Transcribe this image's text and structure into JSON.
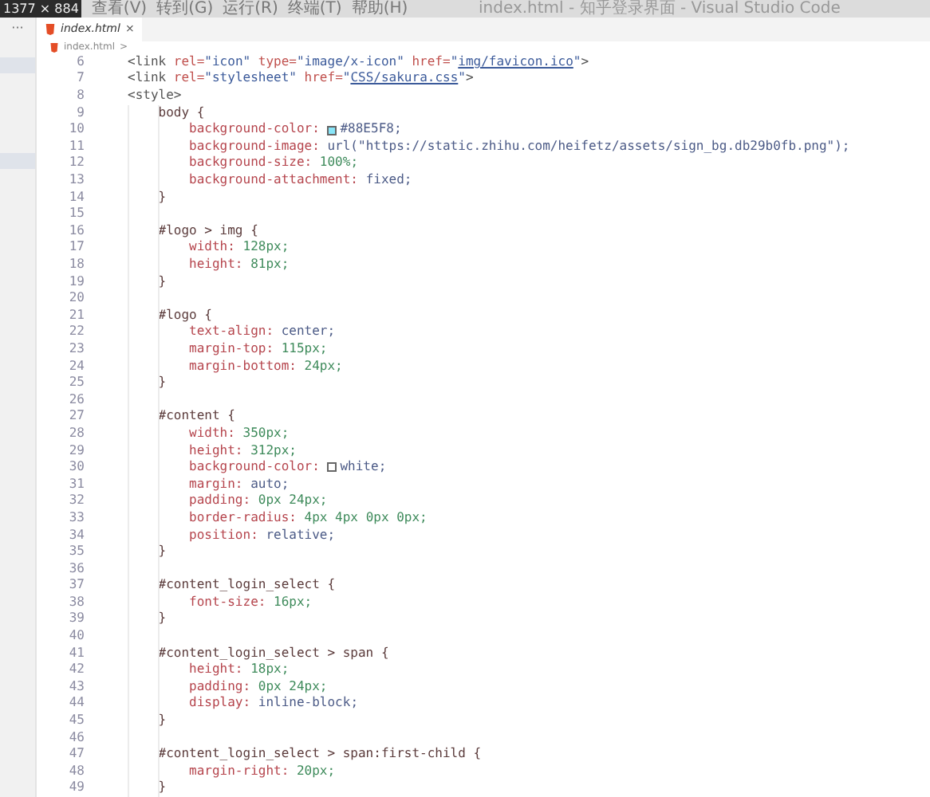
{
  "dimension_label": "1377 × 884",
  "menu": [
    "查看(V)",
    "转到(G)",
    "运行(R)",
    "终端(T)",
    "帮助(H)"
  ],
  "window": {
    "title": "index.html - 知乎登录界面 - Visual Studio Code"
  },
  "sidebar": {
    "overflow": "···"
  },
  "tabs": [
    {
      "label": "index.html",
      "selected": true,
      "close": "×"
    }
  ],
  "breadcrumb": [
    "index.html",
    ">"
  ],
  "lines": [
    {
      "n": "6",
      "tokens": [
        {
          "kind": "tag",
          "t": "<link "
        },
        {
          "kind": "attr",
          "t": "rel="
        },
        {
          "kind": "str",
          "t": "\"icon\" "
        },
        {
          "kind": "attr",
          "t": "type="
        },
        {
          "kind": "str",
          "t": "\"image/x-icon\" "
        },
        {
          "kind": "attr",
          "t": "href="
        },
        {
          "kind": "str",
          "t": "\""
        },
        {
          "kind": "link",
          "t": "img/favicon.ico"
        },
        {
          "kind": "str",
          "t": "\""
        },
        {
          "kind": "tag",
          "t": ">"
        }
      ]
    },
    {
      "n": "7",
      "tokens": [
        {
          "kind": "tag",
          "t": "<link "
        },
        {
          "kind": "attr",
          "t": "rel="
        },
        {
          "kind": "str",
          "t": "\"stylesheet\" "
        },
        {
          "kind": "attr",
          "t": "href="
        },
        {
          "kind": "str",
          "t": "\""
        },
        {
          "kind": "link",
          "t": "CSS/sakura.css"
        },
        {
          "kind": "str",
          "t": "\""
        },
        {
          "kind": "tag",
          "t": ">"
        }
      ]
    },
    {
      "n": "8",
      "tokens": [
        {
          "kind": "tag",
          "t": "<style>"
        }
      ]
    },
    {
      "n": "9",
      "tokens": [
        {
          "kind": "sel",
          "t": "    body {"
        }
      ]
    },
    {
      "n": "10",
      "tokens": [
        {
          "kind": "prop",
          "t": "        background-color: "
        },
        {
          "kind": "swatch",
          "color": "#88e5f8"
        },
        {
          "kind": "val",
          "t": "#88E5F8;"
        }
      ]
    },
    {
      "n": "11",
      "tokens": [
        {
          "kind": "prop",
          "t": "        background-image: "
        },
        {
          "kind": "val",
          "t": "url(\"https://static.zhihu.com/heifetz/assets/sign_bg.db29b0fb.png\");"
        }
      ]
    },
    {
      "n": "12",
      "tokens": [
        {
          "kind": "prop",
          "t": "        background-size: "
        },
        {
          "kind": "num",
          "t": "100%;"
        }
      ]
    },
    {
      "n": "13",
      "tokens": [
        {
          "kind": "prop",
          "t": "        background-attachment: "
        },
        {
          "kind": "val",
          "t": "fixed;"
        }
      ]
    },
    {
      "n": "14",
      "tokens": [
        {
          "kind": "sel",
          "t": "    }"
        }
      ]
    },
    {
      "n": "15"
    },
    {
      "n": "16",
      "tokens": [
        {
          "kind": "sel",
          "t": "    #logo > img {"
        }
      ]
    },
    {
      "n": "17",
      "tokens": [
        {
          "kind": "prop",
          "t": "        width: "
        },
        {
          "kind": "num",
          "t": "128px;"
        }
      ]
    },
    {
      "n": "18",
      "tokens": [
        {
          "kind": "prop",
          "t": "        height: "
        },
        {
          "kind": "num",
          "t": "81px;"
        }
      ]
    },
    {
      "n": "19",
      "tokens": [
        {
          "kind": "sel",
          "t": "    }"
        }
      ]
    },
    {
      "n": "20"
    },
    {
      "n": "21",
      "tokens": [
        {
          "kind": "sel",
          "t": "    #logo {"
        }
      ]
    },
    {
      "n": "22",
      "tokens": [
        {
          "kind": "prop",
          "t": "        text-align: "
        },
        {
          "kind": "val",
          "t": "center;"
        }
      ]
    },
    {
      "n": "23",
      "tokens": [
        {
          "kind": "prop",
          "t": "        margin-top: "
        },
        {
          "kind": "num",
          "t": "115px;"
        }
      ]
    },
    {
      "n": "24",
      "tokens": [
        {
          "kind": "prop",
          "t": "        margin-bottom: "
        },
        {
          "kind": "num",
          "t": "24px;"
        }
      ]
    },
    {
      "n": "25",
      "tokens": [
        {
          "kind": "sel",
          "t": "    }"
        }
      ]
    },
    {
      "n": "26"
    },
    {
      "n": "27",
      "tokens": [
        {
          "kind": "sel",
          "t": "    #content {"
        }
      ]
    },
    {
      "n": "28",
      "tokens": [
        {
          "kind": "prop",
          "t": "        width: "
        },
        {
          "kind": "num",
          "t": "350px;"
        }
      ]
    },
    {
      "n": "29",
      "tokens": [
        {
          "kind": "prop",
          "t": "        height: "
        },
        {
          "kind": "num",
          "t": "312px;"
        }
      ]
    },
    {
      "n": "30",
      "tokens": [
        {
          "kind": "prop",
          "t": "        background-color: "
        },
        {
          "kind": "swatch",
          "color": "#ffffff"
        },
        {
          "kind": "val",
          "t": "white;"
        }
      ]
    },
    {
      "n": "31",
      "tokens": [
        {
          "kind": "prop",
          "t": "        margin: "
        },
        {
          "kind": "val",
          "t": "auto;"
        }
      ]
    },
    {
      "n": "32",
      "tokens": [
        {
          "kind": "prop",
          "t": "        padding: "
        },
        {
          "kind": "num",
          "t": "0px 24px;"
        }
      ]
    },
    {
      "n": "33",
      "tokens": [
        {
          "kind": "prop",
          "t": "        border-radius: "
        },
        {
          "kind": "num",
          "t": "4px 4px 0px 0px;"
        }
      ]
    },
    {
      "n": "34",
      "tokens": [
        {
          "kind": "prop",
          "t": "        position: "
        },
        {
          "kind": "val",
          "t": "relative;"
        }
      ]
    },
    {
      "n": "35",
      "tokens": [
        {
          "kind": "sel",
          "t": "    }"
        }
      ]
    },
    {
      "n": "36"
    },
    {
      "n": "37",
      "tokens": [
        {
          "kind": "sel",
          "t": "    #content_login_select {"
        }
      ]
    },
    {
      "n": "38",
      "tokens": [
        {
          "kind": "prop",
          "t": "        font-size: "
        },
        {
          "kind": "num",
          "t": "16px;"
        }
      ]
    },
    {
      "n": "39",
      "tokens": [
        {
          "kind": "sel",
          "t": "    }"
        }
      ]
    },
    {
      "n": "40"
    },
    {
      "n": "41",
      "tokens": [
        {
          "kind": "sel",
          "t": "    #content_login_select > span {"
        }
      ]
    },
    {
      "n": "42",
      "tokens": [
        {
          "kind": "prop",
          "t": "        height: "
        },
        {
          "kind": "num",
          "t": "18px;"
        }
      ]
    },
    {
      "n": "43",
      "tokens": [
        {
          "kind": "prop",
          "t": "        padding: "
        },
        {
          "kind": "num",
          "t": "0px 24px;"
        }
      ]
    },
    {
      "n": "44",
      "tokens": [
        {
          "kind": "prop",
          "t": "        display: "
        },
        {
          "kind": "val",
          "t": "inline-block;"
        }
      ]
    },
    {
      "n": "45",
      "tokens": [
        {
          "kind": "sel",
          "t": "    }"
        }
      ]
    },
    {
      "n": "46"
    },
    {
      "n": "47",
      "tokens": [
        {
          "kind": "sel",
          "t": "    #content_login_select > span:first-child {"
        }
      ]
    },
    {
      "n": "48",
      "tokens": [
        {
          "kind": "prop",
          "t": "        margin-right: "
        },
        {
          "kind": "num",
          "t": "20px;"
        }
      ]
    },
    {
      "n": "49",
      "tokens": [
        {
          "kind": "sel",
          "t": "    }"
        }
      ]
    }
  ]
}
